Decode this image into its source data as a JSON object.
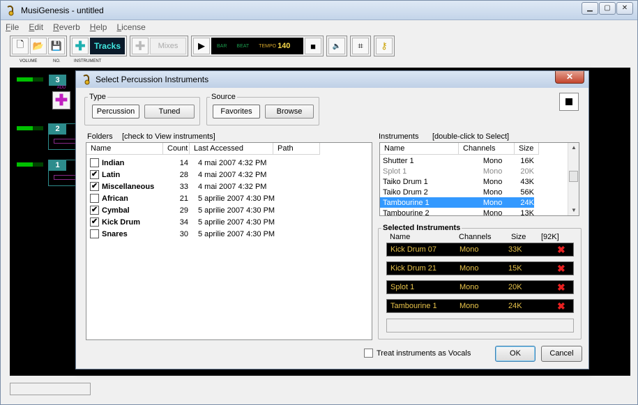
{
  "main": {
    "title": "MusiGenesis - untitled",
    "menu": [
      "File",
      "Edit",
      "Reverb",
      "Help",
      "License"
    ],
    "tracks_label": "Tracks",
    "mixes_label": "Mixes",
    "counter": {
      "bar": "BAR",
      "beat": "BEAT",
      "tempo_label": "TEMPO",
      "tempo_value": "140"
    },
    "col_labels": [
      "VOLUME",
      "NO.",
      "INSTRUMENT"
    ],
    "tracks": [
      {
        "num": "3"
      },
      {
        "num": "2"
      },
      {
        "num": "1"
      }
    ],
    "add_label": "ADD",
    "win_buttons": [
      "minimize-icon",
      "maximize-icon",
      "close-icon"
    ]
  },
  "dialog": {
    "title": "Select Percussion Instruments",
    "close_label": "✕",
    "type": {
      "legend": "Type",
      "options": [
        "Percussion",
        "Tuned"
      ],
      "selected": "Percussion"
    },
    "source": {
      "legend": "Source",
      "options": [
        "Favorites",
        "Browse"
      ],
      "selected": "Favorites"
    },
    "folders": {
      "label": "Folders",
      "hint": "[check to View instruments]",
      "columns": [
        "Name",
        "Count",
        "Last Accessed",
        "Path"
      ],
      "rows": [
        {
          "checked": false,
          "name": "Indian",
          "count": "14",
          "date": "4 mai 2007 4:32 PM"
        },
        {
          "checked": true,
          "name": "Latin",
          "count": "28",
          "date": "4 mai 2007 4:32 PM"
        },
        {
          "checked": true,
          "name": "Miscellaneous",
          "count": "33",
          "date": "4 mai 2007 4:32 PM"
        },
        {
          "checked": false,
          "name": "African",
          "count": "21",
          "date": "5 aprilie 2007 4:30 PM"
        },
        {
          "checked": true,
          "name": "Cymbal",
          "count": "29",
          "date": "5 aprilie 2007 4:30 PM"
        },
        {
          "checked": true,
          "name": "Kick Drum",
          "count": "34",
          "date": "5 aprilie 2007 4:30 PM"
        },
        {
          "checked": false,
          "name": "Snares",
          "count": "30",
          "date": "5 aprilie 2007 4:30 PM"
        }
      ]
    },
    "instruments": {
      "label": "Instruments",
      "hint": "[double-click to Select]",
      "columns": [
        "Name",
        "Channels",
        "Size"
      ],
      "rows": [
        {
          "name": "Shutter 1",
          "channels": "Mono",
          "size": "16K",
          "state": ""
        },
        {
          "name": "Splot 1",
          "channels": "Mono",
          "size": "20K",
          "state": "grey"
        },
        {
          "name": "Taiko Drum 1",
          "channels": "Mono",
          "size": "43K",
          "state": ""
        },
        {
          "name": "Taiko Drum 2",
          "channels": "Mono",
          "size": "56K",
          "state": ""
        },
        {
          "name": "Tambourine 1",
          "channels": "Mono",
          "size": "24K",
          "state": "selected"
        },
        {
          "name": "Tambourine 2",
          "channels": "Mono",
          "size": "13K",
          "state": ""
        }
      ]
    },
    "selected": {
      "legend": "Selected Instruments",
      "columns": [
        "Name",
        "Channels",
        "Size",
        "[92K]"
      ],
      "rows": [
        {
          "name": "Kick Drum 07",
          "channels": "Mono",
          "size": "33K"
        },
        {
          "name": "Kick Drum 21",
          "channels": "Mono",
          "size": "15K"
        },
        {
          "name": "Splot 1",
          "channels": "Mono",
          "size": "20K"
        },
        {
          "name": "Tambourine 1",
          "channels": "Mono",
          "size": "24K"
        }
      ],
      "delete_glyph": "✖"
    },
    "vocals_label": "Treat instruments as Vocals",
    "ok_label": "OK",
    "cancel_label": "Cancel"
  }
}
